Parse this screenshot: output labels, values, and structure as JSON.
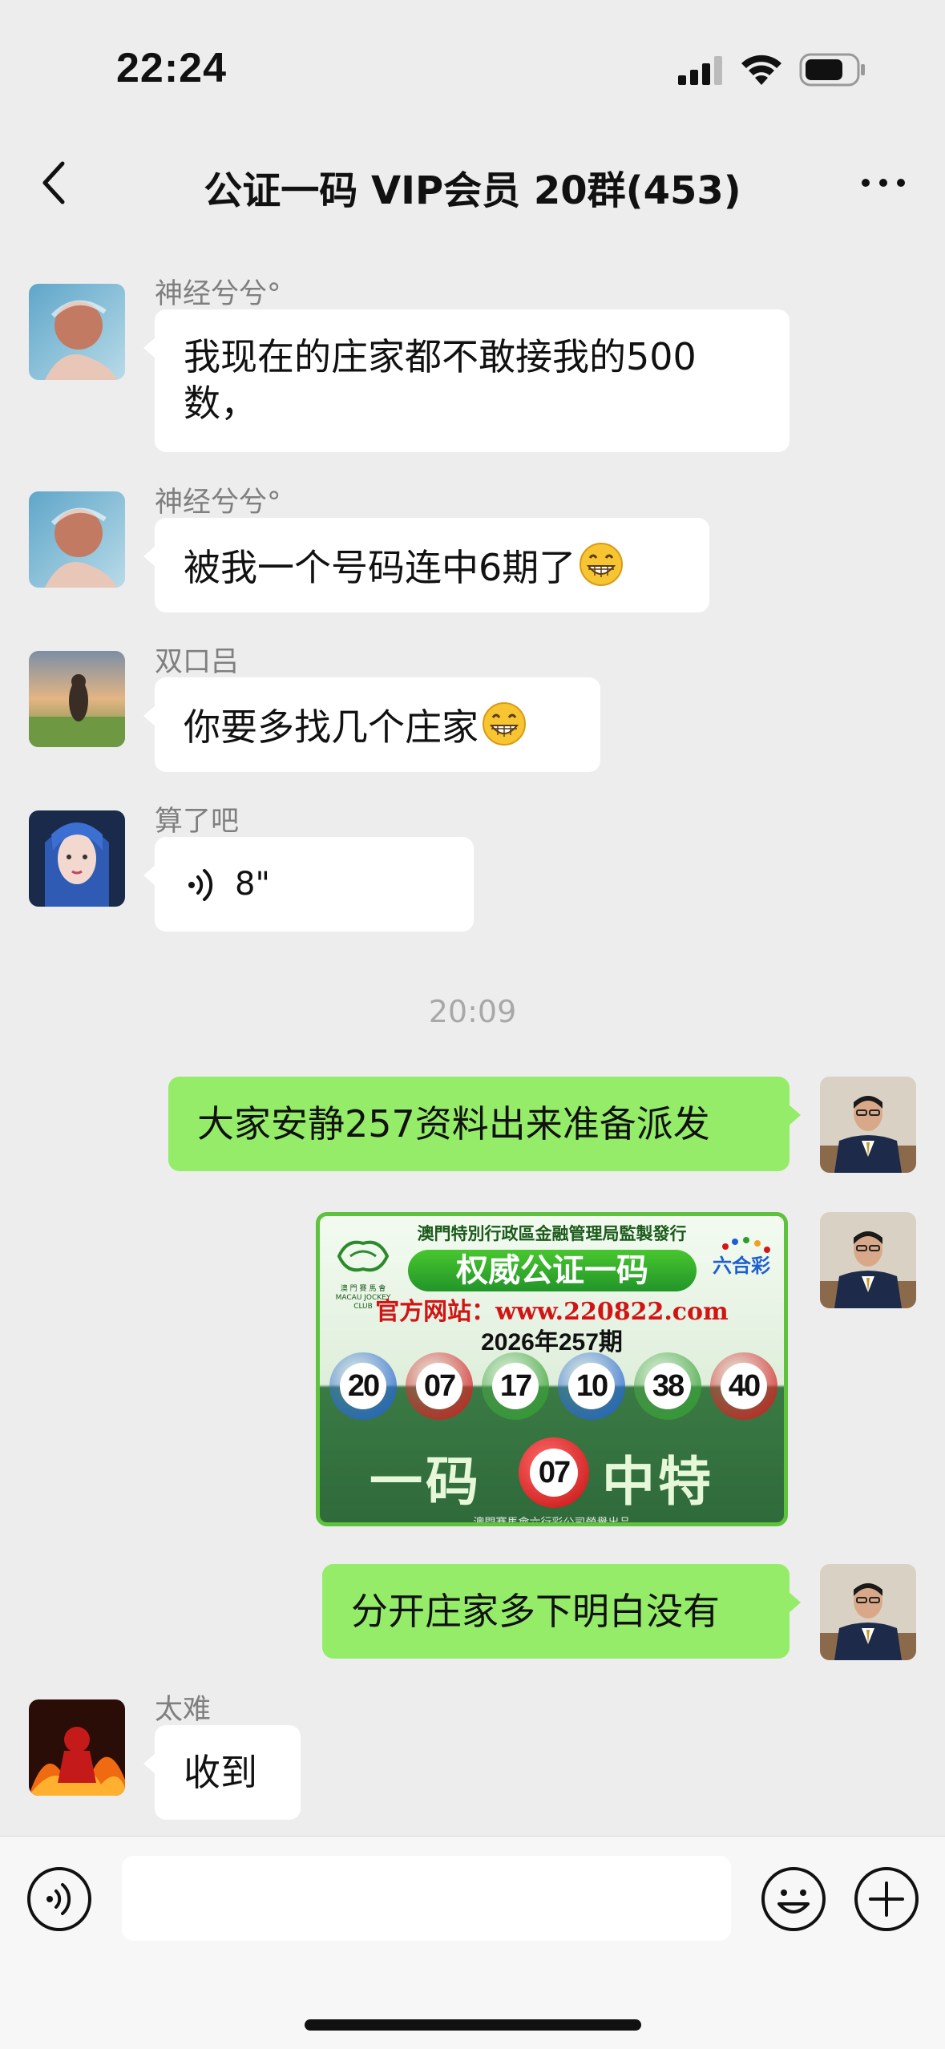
{
  "status_bar": {
    "time": "22:24"
  },
  "nav": {
    "title": "公证一码 VIP会员 20群(453)"
  },
  "messages": [
    {
      "sender": "神经兮兮°",
      "text": "我现在的庄家都不敢接我的500数，",
      "direction": "in"
    },
    {
      "sender": "神经兮兮°",
      "text": "被我一个号码连中6期了",
      "direction": "in",
      "emoji": "grin-icon"
    },
    {
      "sender": "双口吕",
      "text": "你要多找几个庄家",
      "direction": "in",
      "emoji": "grin-icon"
    },
    {
      "sender": "算了吧",
      "duration": "8\"",
      "direction": "in",
      "type": "voice"
    },
    {
      "text": "大家安静257资料出来准备派发",
      "direction": "out"
    },
    {
      "type": "image",
      "direction": "out"
    },
    {
      "text": "分开庄家多下明白没有",
      "direction": "out"
    },
    {
      "sender": "太难",
      "text": "收到",
      "direction": "in"
    }
  ],
  "time_divider": "20:09",
  "lottery": {
    "header": "澳門特別行政區金融管理局監製發行",
    "logo_text": "澳 門 賽 馬 會 MACAU JOCKEY CLUB",
    "brand": "六合彩",
    "banner": "权威公证一码",
    "url": "官方网站：www.220822.com",
    "issue": "2026年257期",
    "balls": [
      {
        "number": "20",
        "color": "#1d5fd1"
      },
      {
        "number": "07",
        "color": "#d4161a"
      },
      {
        "number": "17",
        "color": "#2e9c2c"
      },
      {
        "number": "10",
        "color": "#1d5fd1"
      },
      {
        "number": "38",
        "color": "#2e9c2c"
      },
      {
        "number": "40",
        "color": "#d4161a"
      }
    ],
    "left_word": "一码",
    "special": "07",
    "right_word": "中特",
    "footer": "澳門賽馬會六行彩公司榮譽出品"
  },
  "input": {
    "placeholder": ""
  },
  "colors": {
    "outgoing_bubble": "#95ec69",
    "incoming_bubble": "#ffffff",
    "background": "#ededed"
  }
}
